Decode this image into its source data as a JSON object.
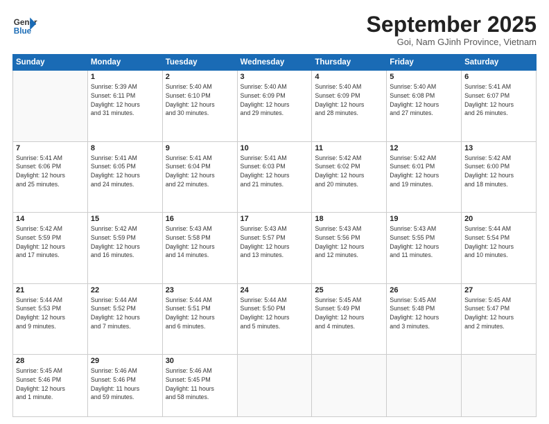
{
  "header": {
    "logo_line1": "General",
    "logo_line2": "Blue",
    "month": "September 2025",
    "location": "Goi, Nam GJinh Province, Vietnam"
  },
  "weekdays": [
    "Sunday",
    "Monday",
    "Tuesday",
    "Wednesday",
    "Thursday",
    "Friday",
    "Saturday"
  ],
  "weeks": [
    [
      {
        "day": "",
        "info": ""
      },
      {
        "day": "1",
        "info": "Sunrise: 5:39 AM\nSunset: 6:11 PM\nDaylight: 12 hours\nand 31 minutes."
      },
      {
        "day": "2",
        "info": "Sunrise: 5:40 AM\nSunset: 6:10 PM\nDaylight: 12 hours\nand 30 minutes."
      },
      {
        "day": "3",
        "info": "Sunrise: 5:40 AM\nSunset: 6:09 PM\nDaylight: 12 hours\nand 29 minutes."
      },
      {
        "day": "4",
        "info": "Sunrise: 5:40 AM\nSunset: 6:09 PM\nDaylight: 12 hours\nand 28 minutes."
      },
      {
        "day": "5",
        "info": "Sunrise: 5:40 AM\nSunset: 6:08 PM\nDaylight: 12 hours\nand 27 minutes."
      },
      {
        "day": "6",
        "info": "Sunrise: 5:41 AM\nSunset: 6:07 PM\nDaylight: 12 hours\nand 26 minutes."
      }
    ],
    [
      {
        "day": "7",
        "info": "Sunrise: 5:41 AM\nSunset: 6:06 PM\nDaylight: 12 hours\nand 25 minutes."
      },
      {
        "day": "8",
        "info": "Sunrise: 5:41 AM\nSunset: 6:05 PM\nDaylight: 12 hours\nand 24 minutes."
      },
      {
        "day": "9",
        "info": "Sunrise: 5:41 AM\nSunset: 6:04 PM\nDaylight: 12 hours\nand 22 minutes."
      },
      {
        "day": "10",
        "info": "Sunrise: 5:41 AM\nSunset: 6:03 PM\nDaylight: 12 hours\nand 21 minutes."
      },
      {
        "day": "11",
        "info": "Sunrise: 5:42 AM\nSunset: 6:02 PM\nDaylight: 12 hours\nand 20 minutes."
      },
      {
        "day": "12",
        "info": "Sunrise: 5:42 AM\nSunset: 6:01 PM\nDaylight: 12 hours\nand 19 minutes."
      },
      {
        "day": "13",
        "info": "Sunrise: 5:42 AM\nSunset: 6:00 PM\nDaylight: 12 hours\nand 18 minutes."
      }
    ],
    [
      {
        "day": "14",
        "info": "Sunrise: 5:42 AM\nSunset: 5:59 PM\nDaylight: 12 hours\nand 17 minutes."
      },
      {
        "day": "15",
        "info": "Sunrise: 5:42 AM\nSunset: 5:59 PM\nDaylight: 12 hours\nand 16 minutes."
      },
      {
        "day": "16",
        "info": "Sunrise: 5:43 AM\nSunset: 5:58 PM\nDaylight: 12 hours\nand 14 minutes."
      },
      {
        "day": "17",
        "info": "Sunrise: 5:43 AM\nSunset: 5:57 PM\nDaylight: 12 hours\nand 13 minutes."
      },
      {
        "day": "18",
        "info": "Sunrise: 5:43 AM\nSunset: 5:56 PM\nDaylight: 12 hours\nand 12 minutes."
      },
      {
        "day": "19",
        "info": "Sunrise: 5:43 AM\nSunset: 5:55 PM\nDaylight: 12 hours\nand 11 minutes."
      },
      {
        "day": "20",
        "info": "Sunrise: 5:44 AM\nSunset: 5:54 PM\nDaylight: 12 hours\nand 10 minutes."
      }
    ],
    [
      {
        "day": "21",
        "info": "Sunrise: 5:44 AM\nSunset: 5:53 PM\nDaylight: 12 hours\nand 9 minutes."
      },
      {
        "day": "22",
        "info": "Sunrise: 5:44 AM\nSunset: 5:52 PM\nDaylight: 12 hours\nand 7 minutes."
      },
      {
        "day": "23",
        "info": "Sunrise: 5:44 AM\nSunset: 5:51 PM\nDaylight: 12 hours\nand 6 minutes."
      },
      {
        "day": "24",
        "info": "Sunrise: 5:44 AM\nSunset: 5:50 PM\nDaylight: 12 hours\nand 5 minutes."
      },
      {
        "day": "25",
        "info": "Sunrise: 5:45 AM\nSunset: 5:49 PM\nDaylight: 12 hours\nand 4 minutes."
      },
      {
        "day": "26",
        "info": "Sunrise: 5:45 AM\nSunset: 5:48 PM\nDaylight: 12 hours\nand 3 minutes."
      },
      {
        "day": "27",
        "info": "Sunrise: 5:45 AM\nSunset: 5:47 PM\nDaylight: 12 hours\nand 2 minutes."
      }
    ],
    [
      {
        "day": "28",
        "info": "Sunrise: 5:45 AM\nSunset: 5:46 PM\nDaylight: 12 hours\nand 1 minute."
      },
      {
        "day": "29",
        "info": "Sunrise: 5:46 AM\nSunset: 5:46 PM\nDaylight: 11 hours\nand 59 minutes."
      },
      {
        "day": "30",
        "info": "Sunrise: 5:46 AM\nSunset: 5:45 PM\nDaylight: 11 hours\nand 58 minutes."
      },
      {
        "day": "",
        "info": ""
      },
      {
        "day": "",
        "info": ""
      },
      {
        "day": "",
        "info": ""
      },
      {
        "day": "",
        "info": ""
      }
    ]
  ]
}
